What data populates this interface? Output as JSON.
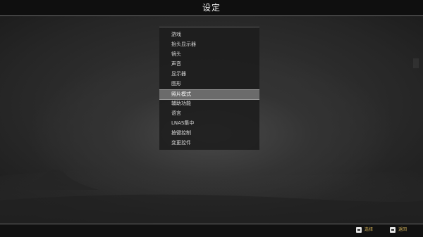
{
  "header": {
    "title": "设定"
  },
  "menu": {
    "items": [
      {
        "label": "游戏",
        "selected": false
      },
      {
        "label": "抬头显示器",
        "selected": false
      },
      {
        "label": "镜头",
        "selected": false
      },
      {
        "label": "声音",
        "selected": false
      },
      {
        "label": "显示器",
        "selected": false
      },
      {
        "label": "图形",
        "selected": false
      },
      {
        "label": "照片模式",
        "selected": true
      },
      {
        "label": "辅助功能",
        "selected": false
      },
      {
        "label": "语言",
        "selected": false
      },
      {
        "label": "LNAS集中",
        "selected": false
      },
      {
        "label": "按键控制",
        "selected": false
      },
      {
        "label": "变更控件",
        "selected": false
      }
    ]
  },
  "footer": {
    "select": {
      "icon": "controller-button-icon",
      "label": "选择"
    },
    "back": {
      "icon": "controller-button-icon",
      "label": "返回"
    }
  }
}
